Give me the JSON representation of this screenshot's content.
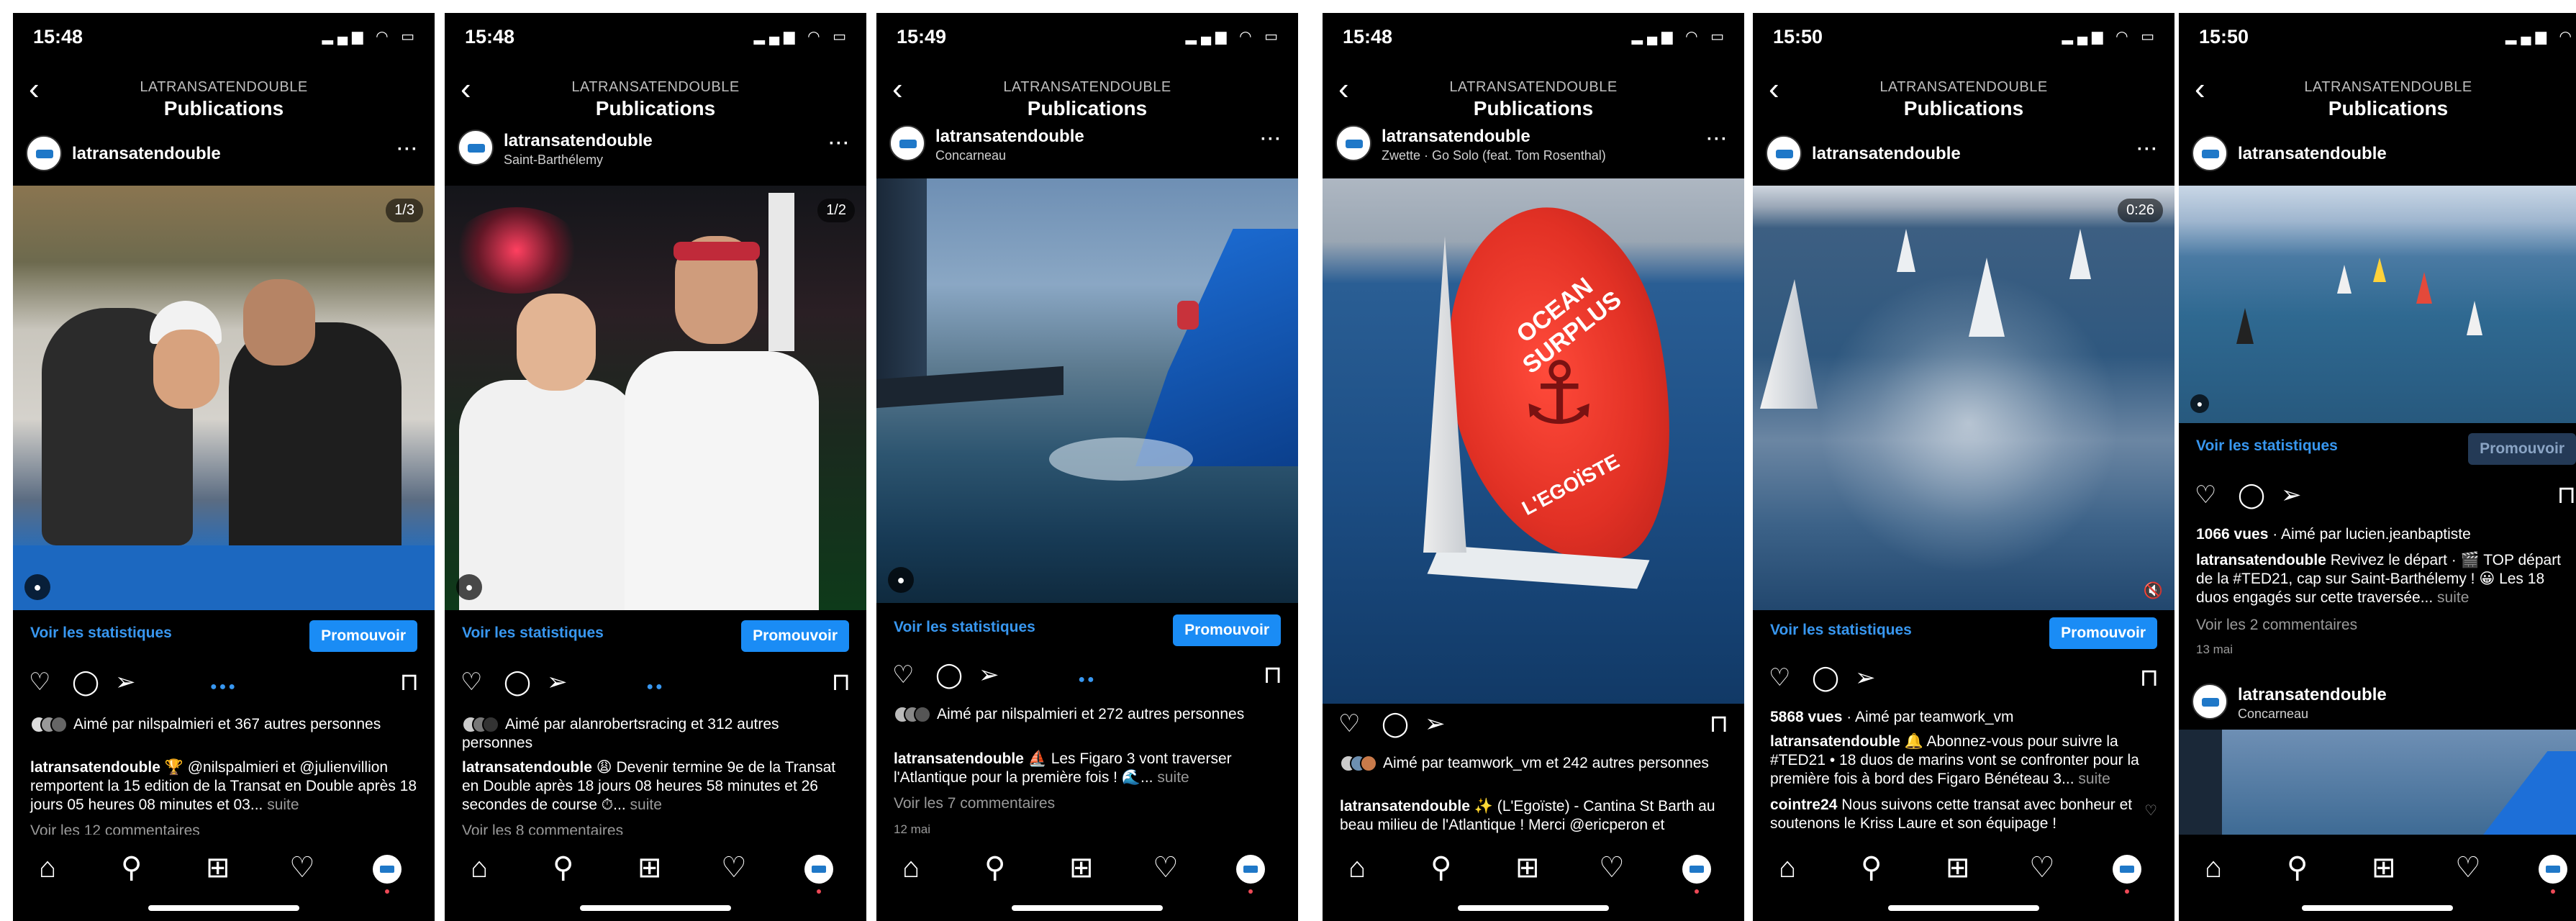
{
  "screens": [
    {
      "time": "15:48",
      "nav_account": "LATRANSATENDOUBLE",
      "nav_title": "Publications",
      "username": "latransatendouble",
      "location": "",
      "counter": "1/3",
      "stats": "Voir les statistiques",
      "promote": "Promouvoir",
      "liked_by": "Aimé par nilspalmieri et 367 autres personnes",
      "caption_user": "latransatendouble",
      "caption": "🏆 @nilspalmieri et @julienvillion remportent la 15 edition de la Transat en Double après 18 jours 05 heures 08 minutes et 03...",
      "more": "suite",
      "comments": "Voir les 12 commentaires"
    },
    {
      "time": "15:48",
      "nav_account": "LATRANSATENDOUBLE",
      "nav_title": "Publications",
      "username": "latransatendouble",
      "location": "Saint-Barthélemy",
      "counter": "1/2",
      "stats": "Voir les statistiques",
      "promote": "Promouvoir",
      "liked_by": "Aimé par alanrobertsracing et 312 autres personnes",
      "caption_user": "latransatendouble",
      "caption": "😩 Devenir termine 9e de la Transat en Double après 18 jours 08 heures 58 minutes et 26 secondes de course ⏱...",
      "more": "suite",
      "comments": "Voir les 8 commentaires"
    },
    {
      "time": "15:49",
      "nav_account": "LATRANSATENDOUBLE",
      "nav_title": "Publications",
      "username": "latransatendouble",
      "location": "Concarneau",
      "stats": "Voir les statistiques",
      "promote": "Promouvoir",
      "liked_by": "Aimé par nilspalmieri et 272 autres personnes",
      "caption_user": "latransatendouble",
      "caption": "⛵ Les Figaro 3 vont traverser l'Atlantique pour la première fois ! 🌊...",
      "more": "suite",
      "comments": "Voir les 7 commentaires",
      "date": "12 mai"
    },
    {
      "time": "15:48",
      "nav_account": "LATRANSATENDOUBLE",
      "nav_title": "Publications",
      "username": "latransatendouble",
      "location": "Zwette · Go Solo (feat. Tom Rosenthal)",
      "sail_text": "OCEAN SURPLUS",
      "sail_text2": "L'EGOÏSTE",
      "liked_by": "Aimé par teamwork_vm et 242 autres personnes",
      "caption_user": "latransatendouble",
      "caption": "✨ (L'Egoïste) - Cantina St Barth au beau milieu de l'Atlantique ! Merci @ericperon et"
    },
    {
      "time": "15:50",
      "nav_account": "LATRANSATENDOUBLE",
      "nav_title": "Publications",
      "username": "latransatendouble",
      "video_time": "0:26",
      "stats": "Voir les statistiques",
      "promote": "Promouvoir",
      "views": "5868 vues",
      "liked_by": "Aimé par teamwork_vm",
      "caption_user": "latransatendouble",
      "caption": "🔔 Abonnez-vous pour suivre la #TED21 • 18 duos de marins vont se confronter pour la première fois à bord des Figaro Bénéteau 3...",
      "more": "suite",
      "comment_user": "cointre24",
      "comment": "Nous suivons cette transat avec bonheur et soutenons le Kriss Laure et son équipage !"
    },
    {
      "time": "15:50",
      "nav_account": "LATRANSATENDOUBLE",
      "nav_title": "Publications",
      "username": "latransatendouble",
      "stats": "Voir les statistiques",
      "promote": "Promouvoir",
      "views": "1066 vues",
      "liked_by": "Aimé par lucien.jeanbaptiste",
      "caption_user": "latransatendouble",
      "caption": "Revivez le départ · 🎬 TOP départ de la #TED21, cap sur Saint-Barthélemy ! 😀 Les 18 duos engagés sur cette traversée...",
      "more": "suite",
      "comments": "Voir les 2 commentaires",
      "date": "13 mai",
      "next_username": "latransatendouble",
      "next_location": "Concarneau"
    }
  ],
  "icons": {
    "back": "chevron-left-icon",
    "more": "ellipsis-icon",
    "like": "heart-icon",
    "comment": "comment-icon",
    "share": "send-icon",
    "save": "bookmark-icon",
    "home": "home-icon",
    "search": "search-icon",
    "create": "plus-square-icon",
    "activity": "heart-icon",
    "profile": "avatar-icon"
  },
  "colors": {
    "link_blue": "#3897f0",
    "promote_blue": "#1a8cf5",
    "background": "#000000"
  }
}
